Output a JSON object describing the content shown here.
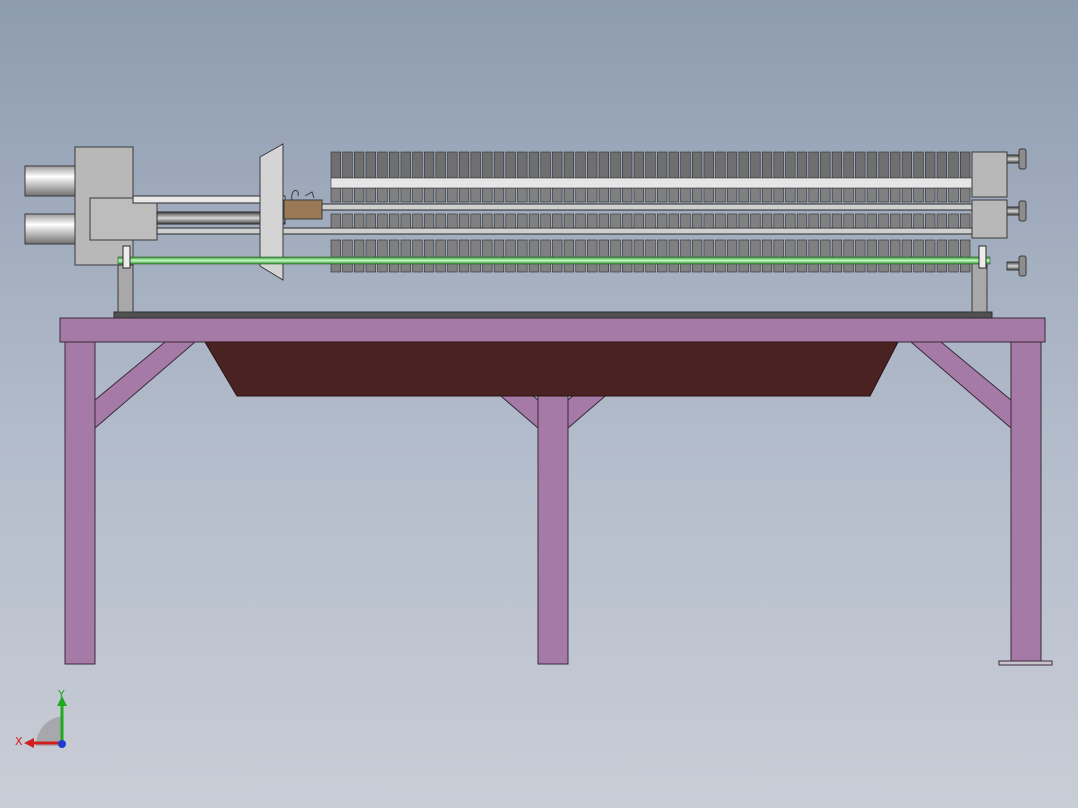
{
  "scene": {
    "plate_count": 55,
    "colors": {
      "background_top": "#8e9cb0",
      "background_bottom": "#c9cdd6",
      "frame": "#a57aa6",
      "tray": "#4a2222",
      "tie_rod": "#6de86d",
      "plate": "#7a7a7a",
      "head_block": "#b8b8b8",
      "connector": "#9a7a56"
    }
  },
  "triad": {
    "x_label": "X",
    "y_label": "Y",
    "icons": [
      "x-axis-arrow",
      "y-axis-arrow",
      "z-axis-dot"
    ]
  }
}
